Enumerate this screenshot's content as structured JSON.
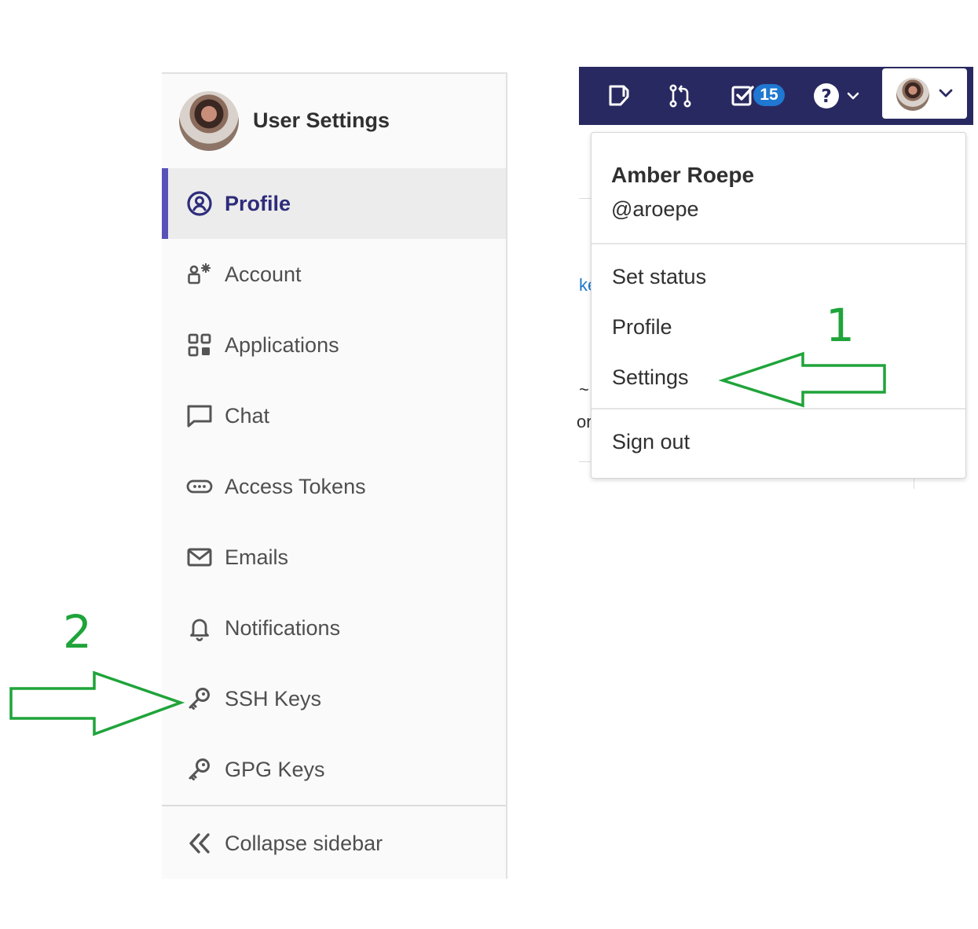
{
  "sidebar": {
    "title": "User Settings",
    "items": [
      {
        "label": "Profile",
        "icon": "profile-icon",
        "active": true
      },
      {
        "label": "Account",
        "icon": "account-icon"
      },
      {
        "label": "Applications",
        "icon": "applications-icon"
      },
      {
        "label": "Chat",
        "icon": "chat-icon"
      },
      {
        "label": "Access Tokens",
        "icon": "access-tokens-icon"
      },
      {
        "label": "Emails",
        "icon": "emails-icon"
      },
      {
        "label": "Notifications",
        "icon": "bell-icon"
      },
      {
        "label": "SSH Keys",
        "icon": "key-icon"
      },
      {
        "label": "GPG Keys",
        "icon": "key-icon"
      }
    ],
    "collapse_label": "Collapse sidebar"
  },
  "topbar": {
    "todo_count": "15",
    "icons": [
      "issues-icon",
      "merge-requests-icon",
      "todos-icon",
      "help-icon",
      "user-avatar"
    ]
  },
  "dropdown": {
    "name": "Amber Roepe",
    "handle": "@aroepe",
    "items": [
      "Set status",
      "Profile",
      "Settings",
      "Sign out"
    ]
  },
  "background_fragments": [
    "ke",
    "~",
    "or"
  ],
  "annotations": {
    "step1": "1",
    "step2": "2"
  },
  "colors": {
    "topbar": "#292961",
    "active_accent": "#5852b8",
    "active_text": "#2e2c7a",
    "badge": "#1f78d1",
    "annotation": "#1fa43a"
  }
}
